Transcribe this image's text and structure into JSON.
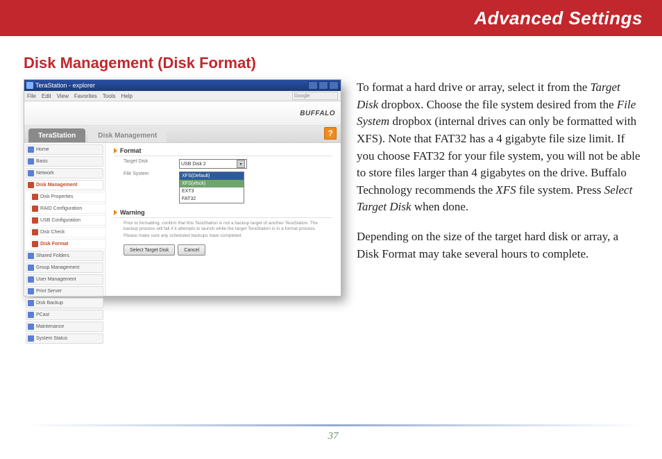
{
  "banner": {
    "title": "Advanced Settings"
  },
  "section": {
    "title": "Disk Management (Disk Format)"
  },
  "body": {
    "p1a": "To format a hard drive or array, select it from the ",
    "em1": "Target Disk",
    "p1b": " dropbox.  Choose the file system desired from the ",
    "em2": "File System",
    "p1c": " dropbox (internal drives can only be formatted with XFS).  Note that FAT32 has a 4 gigabyte file size limit.  If you choose FAT32 for your file system, you will not be able to store files larger than 4 gigabytes on the drive.  Buffalo Technology recommends the ",
    "em3": "XFS",
    "p1d": " file system.  Press ",
    "em4": "Select Target Disk",
    "p1e": " when done.",
    "p2": "Depending on the size of the target hard disk or array, a Disk Format may take several hours to complete."
  },
  "screenshot": {
    "window_title": "TeraStation - explorer",
    "menus": [
      "File",
      "Edit",
      "View",
      "Favorites",
      "Tools",
      "Help"
    ],
    "search_hint": "Google",
    "brand": "BUFFALO",
    "tab_active": "TeraStation",
    "tab_crumb": "Disk Management",
    "help": "?",
    "sidebar": [
      {
        "label": "Home",
        "type": "top"
      },
      {
        "label": "Basic",
        "type": "top"
      },
      {
        "label": "Network",
        "type": "top"
      },
      {
        "label": "Disk Management",
        "type": "top-active"
      },
      {
        "label": "Disk Properties",
        "type": "sub"
      },
      {
        "label": "RAID Configuration",
        "type": "sub"
      },
      {
        "label": "USB Configuration",
        "type": "sub"
      },
      {
        "label": "Disk Check",
        "type": "sub"
      },
      {
        "label": "Disk Format",
        "type": "sub-active"
      },
      {
        "label": "Shared Folders",
        "type": "top"
      },
      {
        "label": "Group Management",
        "type": "top"
      },
      {
        "label": "User Management",
        "type": "top"
      },
      {
        "label": "Print Server",
        "type": "top"
      },
      {
        "label": "Disk Backup",
        "type": "top"
      },
      {
        "label": "PCast",
        "type": "top"
      },
      {
        "label": "Maintenance",
        "type": "top"
      },
      {
        "label": "System Status",
        "type": "top"
      }
    ],
    "form": {
      "section1": "Format",
      "target_label": "Target Disk",
      "target_value": "USB Disk 2",
      "fs_label": "File System",
      "fs_options": [
        "XFS(Default)",
        "XFS(xfsck)",
        "EXT3",
        "FAT32"
      ],
      "section2": "Warning",
      "warn1": "Prior to formatting, confirm that this TeraStation is not a backup target of another TeraStation. The backup process will fail if it attempts to launch while the target TeraStation is in a format process.",
      "warn2": "Please make sure any scheduled backups have completed.",
      "btn_primary": "Select Target Disk",
      "btn_cancel": "Cancel"
    }
  },
  "page_number": "37"
}
